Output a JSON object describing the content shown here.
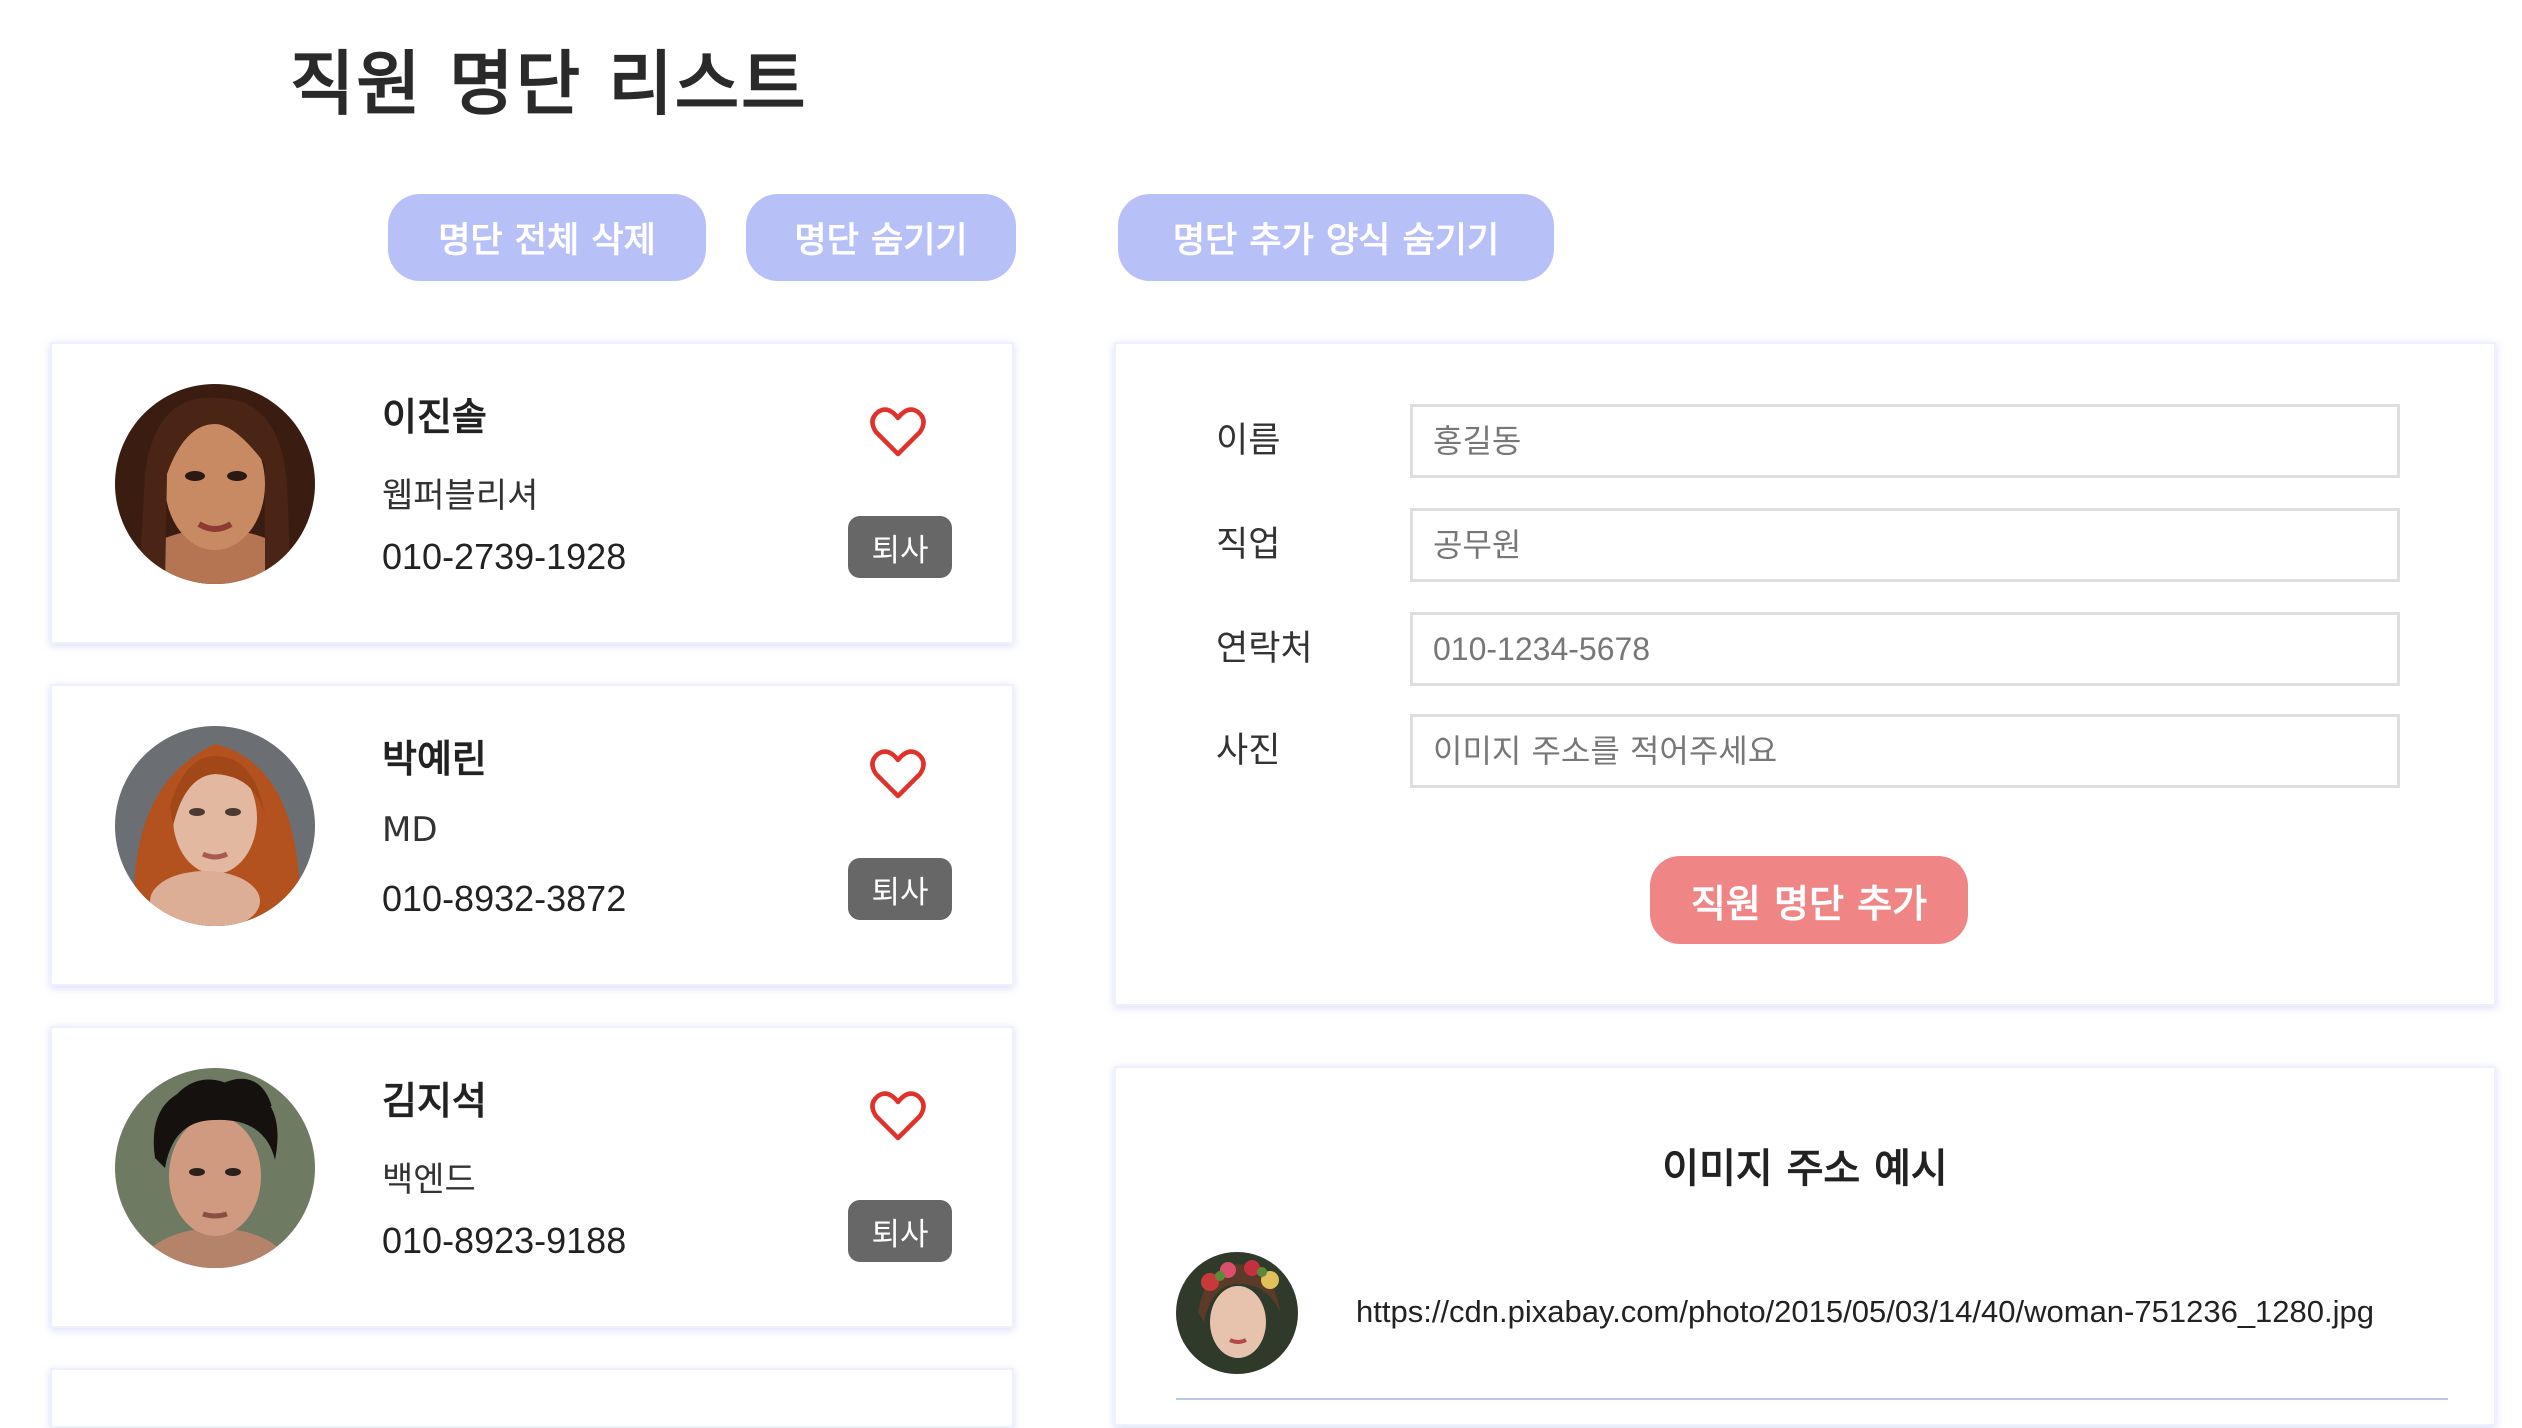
{
  "page": {
    "title": "직원 명단 리스트"
  },
  "toolbar": {
    "delete_all_label": "명단 전체 삭제",
    "hide_list_label": "명단 숨기기",
    "hide_form_label": "명단 추가 양식 숨기기"
  },
  "employees": [
    {
      "name": "이진솔",
      "job": "웹퍼블리셔",
      "phone": "010-2739-1928",
      "quit_label": "퇴사",
      "favorite": false
    },
    {
      "name": "박예린",
      "job": "MD",
      "phone": "010-8932-3872",
      "quit_label": "퇴사",
      "favorite": false
    },
    {
      "name": "김지석",
      "job": "백엔드",
      "phone": "010-8923-9188",
      "quit_label": "퇴사",
      "favorite": false
    }
  ],
  "form": {
    "name_label": "이름",
    "name_placeholder": "홍길동",
    "job_label": "직업",
    "job_placeholder": "공무원",
    "phone_label": "연락처",
    "phone_placeholder": "010-1234-5678",
    "photo_label": "사진",
    "photo_placeholder": "이미지 주소를 적어주세요",
    "submit_label": "직원 명단 추가"
  },
  "example": {
    "title": "이미지 주소 예시",
    "url": "https://cdn.pixabay.com/photo/2015/05/03/14/40/woman-751236_1280.jpg"
  },
  "colors": {
    "pill_button": "#b8c1f7",
    "submit_button": "#f08585",
    "quit_button": "#676767",
    "heart": "#e0322a"
  }
}
